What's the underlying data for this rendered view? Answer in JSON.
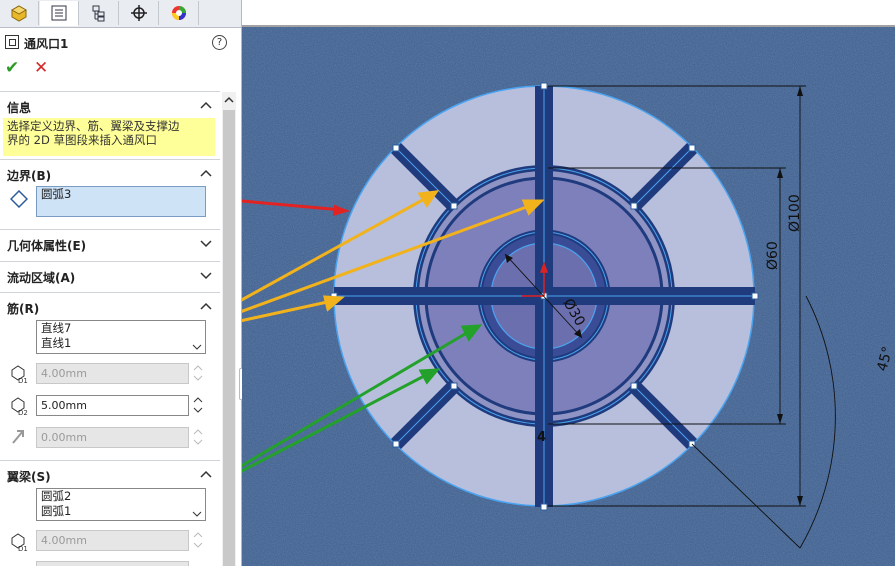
{
  "panel": {
    "tabs": [
      {
        "name": "feature-manager-tab",
        "icon": "feature-tree-icon"
      },
      {
        "name": "property-manager-tab",
        "icon": "property-manager-icon"
      },
      {
        "name": "configuration-manager-tab",
        "icon": "configuration-icon"
      },
      {
        "name": "dimxpert-tab",
        "icon": "crosshair-icon"
      },
      {
        "name": "display-manager-tab",
        "icon": "appearance-icon"
      }
    ],
    "feature_title": "通风口1",
    "help": "?",
    "ok": "✔",
    "cancel": "✕",
    "info": {
      "label": "信息",
      "text_line1": "选择定义边界、筋、翼梁及支撑边",
      "text_line2": "界的 2D 草图段来插入通风口"
    },
    "boundary": {
      "label": "边界(B)",
      "value": "圆弧3"
    },
    "geometry": {
      "label": "几何体属性(E)"
    },
    "flow": {
      "label": "流动区域(A)"
    },
    "ribs": {
      "label": "筋(R)",
      "items": [
        "直线7",
        "直线1"
      ],
      "depth": "4.00mm",
      "width": "5.00mm",
      "offset": "0.00mm",
      "d1": "D1",
      "d2": "D2"
    },
    "spars": {
      "label": "翼梁(S)",
      "items": [
        "圆弧2",
        "圆弧1"
      ],
      "depth": "4.00mm",
      "d1": "D1"
    }
  },
  "drawing": {
    "dims": {
      "d100": "Ø100",
      "d60": "Ø60",
      "d30": "Ø30",
      "width": "4",
      "angle": "45°"
    },
    "colors": {
      "background": "#3b5d8e",
      "vent_face": "#b7bfdc",
      "spar_ring": "#8f94c4",
      "inner_face": "#6c6fae",
      "rib": "#1f3b7e",
      "sketch_line": "#4aa3f0",
      "red_arrow": "#e32222",
      "orange_arrow": "#f2b21b",
      "green_arrow": "#23a12b"
    }
  }
}
